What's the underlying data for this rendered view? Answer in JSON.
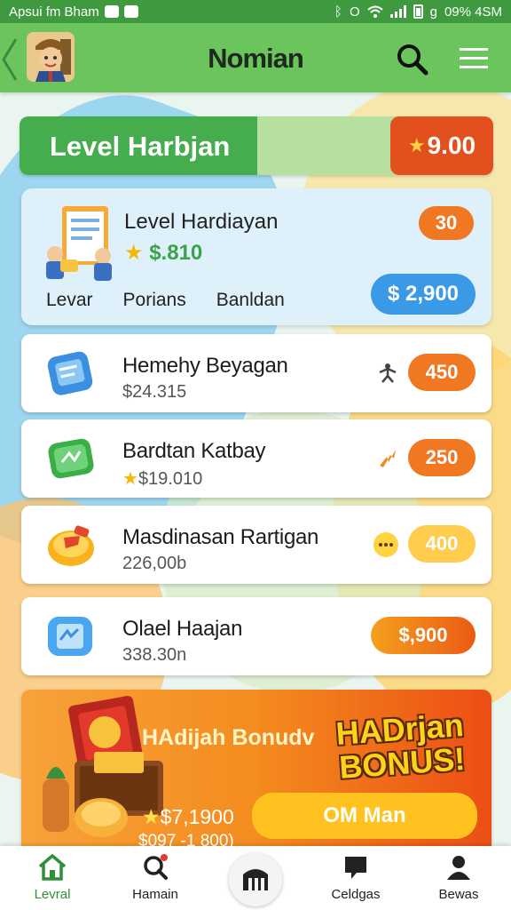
{
  "status_bar": {
    "left_text": "Apsui fm Bham",
    "right_text": "09% 4SM",
    "glyph_a": "ᛒ",
    "glyph_b": "O",
    "glyph_c": "g"
  },
  "app_bar": {
    "title": "Nomian",
    "avatar_icon": "cartoon-character-avatar",
    "search_icon": "search-icon",
    "menu_icon": "hamburger-menu-icon"
  },
  "level_banner": {
    "title": "Level Harbjan",
    "score": "9.00"
  },
  "level_card": {
    "title": "Level Hardiayan",
    "subtitle": "$.810",
    "tabs": [
      "Levar",
      "Porians",
      "Banldan"
    ],
    "badge": "30",
    "button": "$ 2,900"
  },
  "items": [
    {
      "title": "Hemehy Beyagan",
      "value": "$24.315",
      "badge": "450",
      "icon": "blue-notepad-icon",
      "mark": "figure-icon",
      "accent": "#f07822"
    },
    {
      "title": "Bardtan Katbay",
      "value": "$19.010",
      "badge": "250",
      "icon": "green-ticket-icon",
      "mark": "orange-arrow-icon",
      "accent": "#f07822"
    },
    {
      "title": "Masdinasan Rartigan",
      "value": "226,00b",
      "badge": "400",
      "icon": "yellow-coin-purse-icon",
      "mark": "dots-icon",
      "accent": "#ffcc4d"
    },
    {
      "title": "Olael Haajan",
      "value": "338.30n",
      "badge": "$,900",
      "icon": "blue-document-icon",
      "mark": "",
      "accent": "#f07822"
    }
  ],
  "bonus": {
    "title": "HAdijah Bonudv",
    "headline_line1": "HADrjan",
    "headline_line2": "BONUS!",
    "amount": "$7,1900",
    "sub_amount": "$097 -1 800)",
    "button": "OM Man"
  },
  "bottom_nav": {
    "items": [
      {
        "label": "Levral",
        "icon": "home-icon",
        "active": true
      },
      {
        "label": "Hamain",
        "icon": "search-icon",
        "active": false
      },
      {
        "label": "Celdgas",
        "icon": "chat-icon",
        "active": false
      },
      {
        "label": "Bewas",
        "icon": "profile-icon",
        "active": false
      }
    ],
    "center_icon": "grid-icon"
  },
  "colors": {
    "primary_green": "#6cc45c",
    "banner_green": "#46ad4f",
    "orange": "#f07822",
    "blue_button": "#3a9ae6",
    "bonus_yellow": "#ffc21e"
  }
}
